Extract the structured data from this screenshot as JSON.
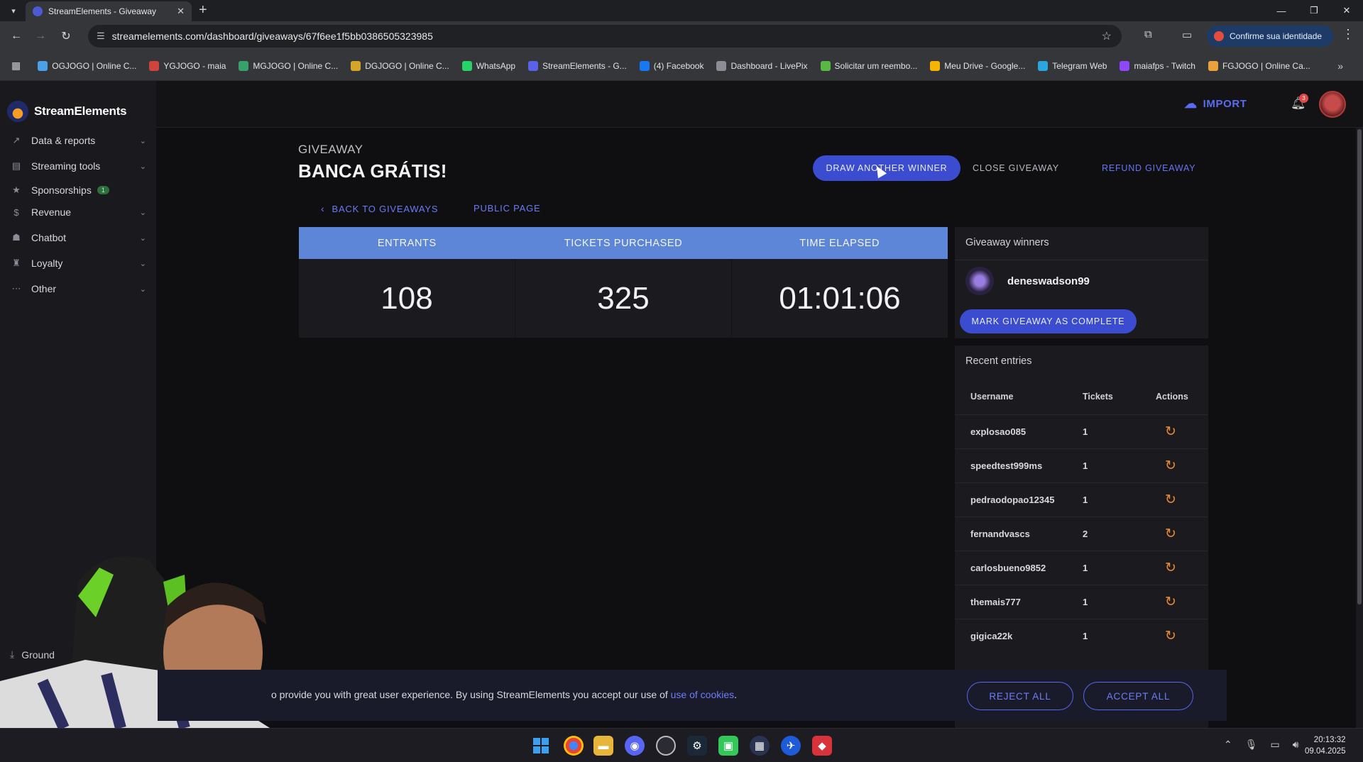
{
  "browser": {
    "tab_title": "StreamElements - Giveaway",
    "tab_close": "✕",
    "new_tab": "+",
    "url": "streamelements.com/dashboard/giveaways/67f6ee1f5bb0386505323985",
    "identity_button": "Confirme sua identidade",
    "bookmarks": [
      {
        "label": "OGJOGO | Online C...",
        "color": "#4aa1e8"
      },
      {
        "label": "YGJOGO - maia",
        "color": "#d0453a"
      },
      {
        "label": "MGJOGO | Online C...",
        "color": "#38a169"
      },
      {
        "label": "DGJOGO | Online C...",
        "color": "#d4a528"
      },
      {
        "label": "WhatsApp",
        "color": "#25d366"
      },
      {
        "label": "StreamElements - G...",
        "color": "#5a63e8"
      },
      {
        "label": "(4) Facebook",
        "color": "#1877f2"
      },
      {
        "label": "Dashboard - LivePix",
        "color": "#8d8d95"
      },
      {
        "label": "Solicitar um reembo...",
        "color": "#58b845"
      },
      {
        "label": "Meu Drive - Google...",
        "color": "#f4b400"
      },
      {
        "label": "Telegram Web",
        "color": "#2aa5df"
      },
      {
        "label": "maiafps - Twitch",
        "color": "#9146ff"
      },
      {
        "label": "FGJOGO | Online Ca...",
        "color": "#e8a43a"
      }
    ]
  },
  "app": {
    "brand": "StreamElements",
    "header": {
      "import_label": "IMPORT",
      "notifications_count": "3"
    },
    "sidebar": {
      "items": [
        {
          "label": "Data & reports",
          "icon": "chart-icon",
          "glyph": "↗"
        },
        {
          "label": "Streaming tools",
          "icon": "tools-icon",
          "glyph": "▤"
        },
        {
          "label": "Sponsorships",
          "icon": "star-icon",
          "glyph": "★",
          "badge": "1"
        },
        {
          "label": "Revenue",
          "icon": "dollar-icon",
          "glyph": "$"
        },
        {
          "label": "Chatbot",
          "icon": "robot-icon",
          "glyph": "☗"
        },
        {
          "label": "Loyalty",
          "icon": "loyalty-icon",
          "glyph": "♜"
        },
        {
          "label": "Other",
          "icon": "more-icon",
          "glyph": "⋯"
        }
      ],
      "ground_label": "Ground"
    },
    "giveaway": {
      "kicker": "GIVEAWAY",
      "title": "BANCA GRÁTIS!",
      "draw_button": "DRAW ANOTHER WINNER",
      "close_button": "CLOSE GIVEAWAY",
      "refund_button": "REFUND GIVEAWAY",
      "back_link": "BACK TO GIVEAWAYS",
      "public_link": "PUBLIC PAGE",
      "stats": {
        "headers": [
          "ENTRANTS",
          "TICKETS PURCHASED",
          "TIME ELAPSED"
        ],
        "values": [
          "108",
          "325",
          "01:01:06"
        ]
      },
      "winners": {
        "title": "Giveaway winners",
        "winner_name": "deneswadson99",
        "complete_button": "MARK GIVEAWAY AS COMPLETE"
      },
      "recent_entries": {
        "title": "Recent entries",
        "columns": [
          "Username",
          "Tickets",
          "Actions"
        ],
        "rows": [
          {
            "username": "explosao085",
            "tickets": "1"
          },
          {
            "username": "speedtest999ms",
            "tickets": "1"
          },
          {
            "username": "pedraodopao12345",
            "tickets": "1"
          },
          {
            "username": "fernandvascs",
            "tickets": "2"
          },
          {
            "username": "carlosbueno9852",
            "tickets": "1"
          },
          {
            "username": "themais777",
            "tickets": "1"
          },
          {
            "username": "gigica22k",
            "tickets": "1"
          }
        ]
      }
    },
    "cookie_banner": {
      "text": "o provide you with great user experience. By using StreamElements you accept our use of ",
      "link": "use of cookies",
      "period": ".",
      "reject": "REJECT ALL",
      "accept": "ACCEPT ALL"
    }
  },
  "taskbar": {
    "time": "20:13:32",
    "date": "09.04.2025"
  }
}
